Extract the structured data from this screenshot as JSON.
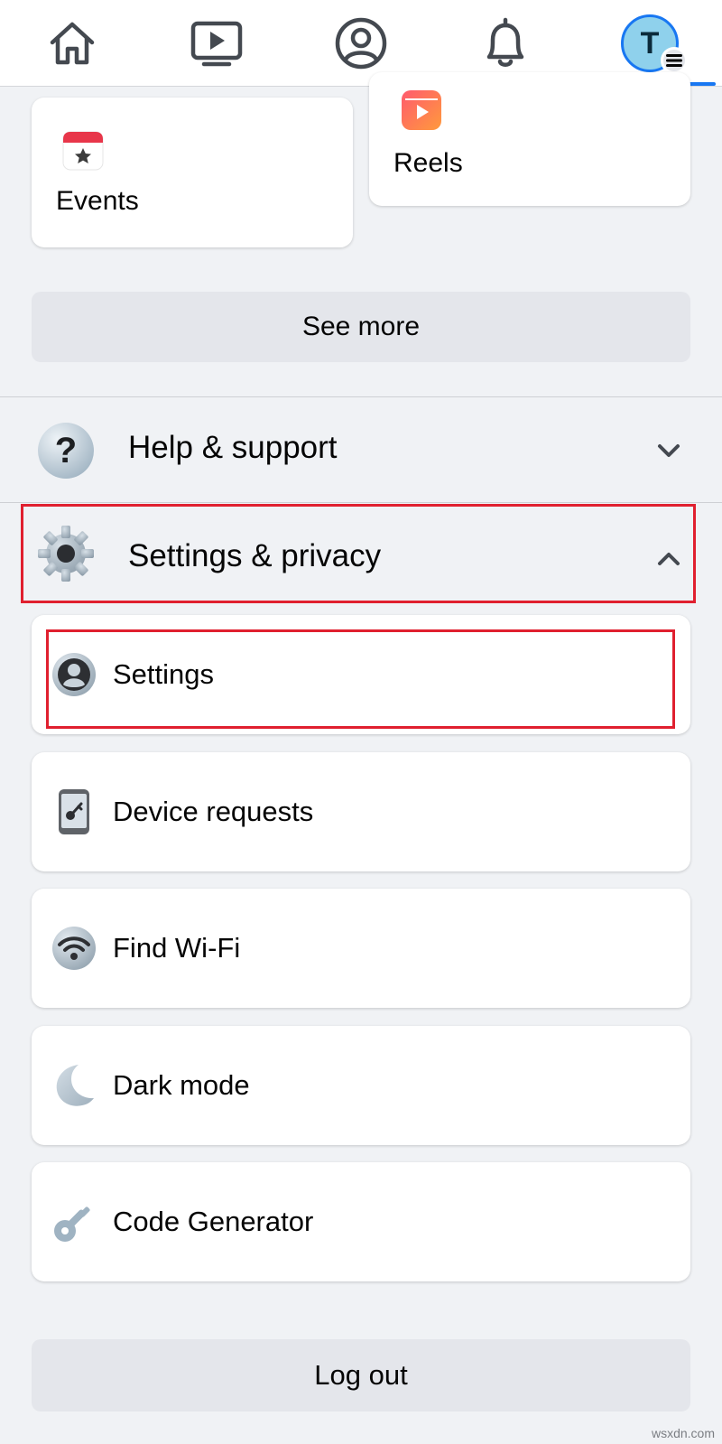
{
  "nav": {
    "tabs": [
      {
        "name": "home",
        "icon": "home-icon"
      },
      {
        "name": "watch",
        "icon": "video-icon"
      },
      {
        "name": "profile",
        "icon": "profile-icon"
      },
      {
        "name": "notifications",
        "icon": "bell-icon"
      },
      {
        "name": "menu",
        "icon": "avatar-menu-icon",
        "active": true
      }
    ],
    "avatar_initial": "T",
    "accent_color": "#1877f2"
  },
  "shortcuts": [
    {
      "label": "Events",
      "icon": "calendar-star-icon"
    },
    {
      "label": "Reels",
      "icon": "reels-icon"
    }
  ],
  "see_more_label": "See more",
  "sections": {
    "help": {
      "label": "Help & support",
      "icon": "question-icon",
      "expanded": false
    },
    "settings_privacy": {
      "label": "Settings & privacy",
      "icon": "gear-icon",
      "expanded": true
    }
  },
  "settings_items": [
    {
      "label": "Settings",
      "icon": "user-circle-icon"
    },
    {
      "label": "Device requests",
      "icon": "phone-key-icon"
    },
    {
      "label": "Find Wi-Fi",
      "icon": "wifi-icon"
    },
    {
      "label": "Dark mode",
      "icon": "moon-icon"
    },
    {
      "label": "Code Generator",
      "icon": "key-icon"
    }
  ],
  "logout_label": "Log out",
  "highlight_color": "#e0202f",
  "watermark": "wsxdn.com"
}
